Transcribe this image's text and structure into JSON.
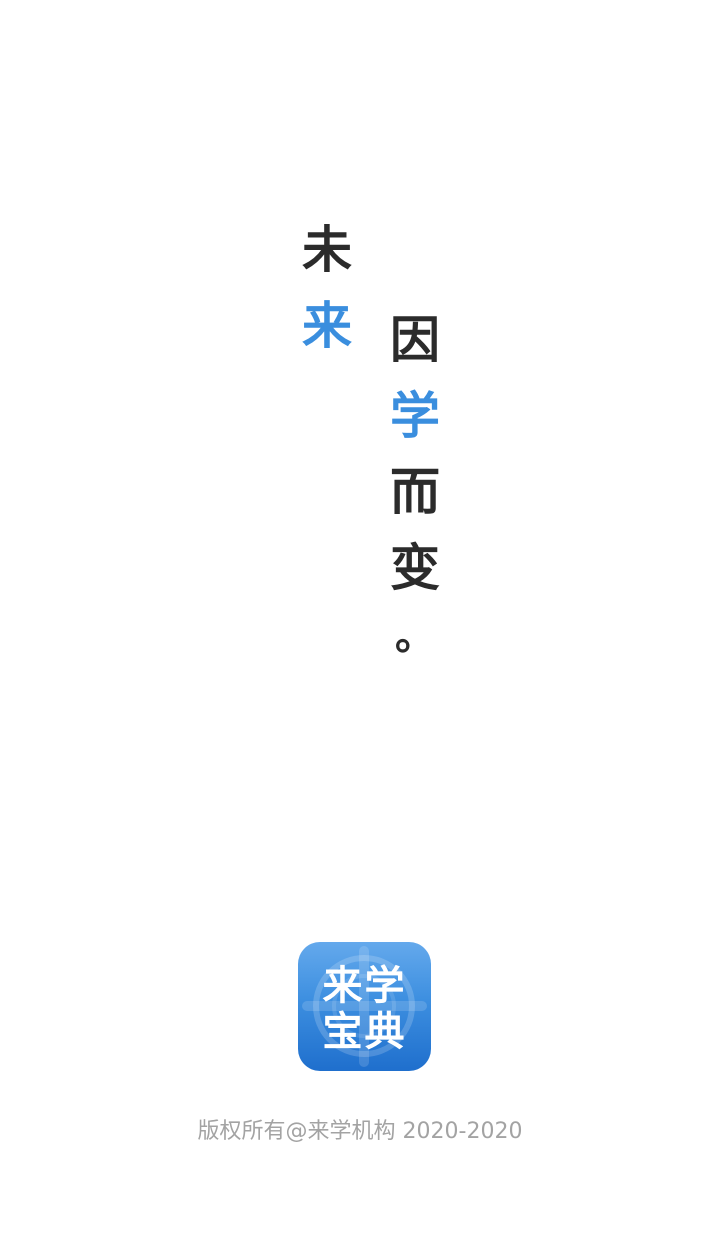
{
  "slogan": {
    "left_column": [
      {
        "char": "未",
        "accent": false
      },
      {
        "char": "来",
        "accent": true
      }
    ],
    "right_column": [
      {
        "char": "因",
        "accent": false
      },
      {
        "char": "学",
        "accent": true
      },
      {
        "char": "而",
        "accent": false
      },
      {
        "char": "变",
        "accent": false
      },
      {
        "char": "。",
        "accent": false
      }
    ],
    "accent_color": "#3a8ede",
    "text_color": "#2b2b2b"
  },
  "app_logo": {
    "line1": "来学",
    "line2": "宝典",
    "background_colors": [
      "#64a9ec",
      "#1f6fcd"
    ]
  },
  "footer": {
    "copyright": "版权所有@来学机构 2020-2020",
    "color": "#a3a3a3"
  }
}
